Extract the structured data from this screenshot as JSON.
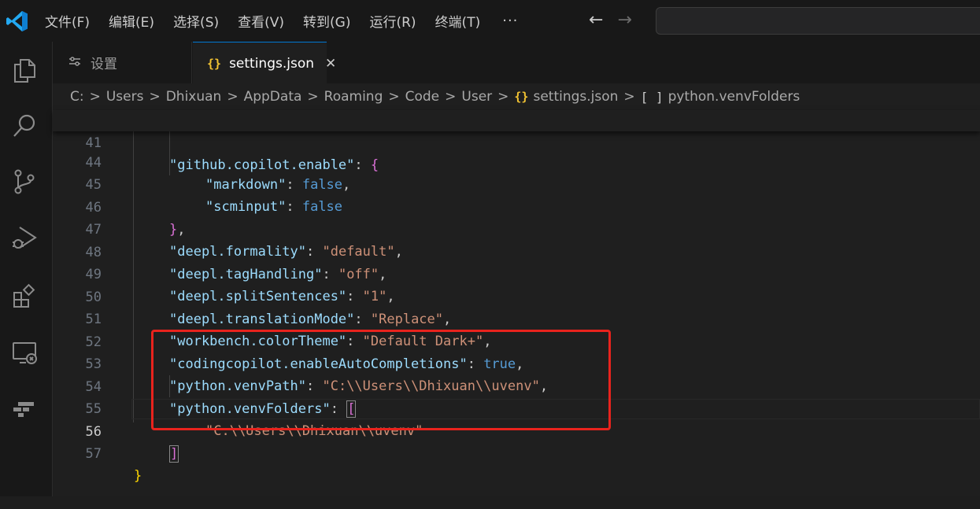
{
  "menu": {
    "items": [
      "文件(F)",
      "编辑(E)",
      "选择(S)",
      "查看(V)",
      "转到(G)",
      "运行(R)",
      "终端(T)"
    ],
    "more": "···"
  },
  "nav": {
    "back": "←",
    "forward": "→"
  },
  "activity_bar": {
    "icons": [
      "explorer-icon",
      "search-icon",
      "source-control-icon",
      "run-debug-icon",
      "extensions-icon",
      "remote-explorer-icon",
      "testing-icon"
    ]
  },
  "tabs": [
    {
      "label": "设置",
      "icon": "settings-icon",
      "active": false
    },
    {
      "label": "settings.json",
      "icon": "json-braces-icon",
      "active": true,
      "close": "✕"
    }
  ],
  "breadcrumb": {
    "items": [
      "C:",
      "Users",
      "Dhixuan",
      "AppData",
      "Roaming",
      "Code",
      "User"
    ],
    "file": "settings.json",
    "file_icon": "{}",
    "symbol": "python.venvFolders",
    "symbol_icon": "[ ]",
    "separator": ">"
  },
  "editor": {
    "lines": [
      {
        "num": "41",
        "tokens": [
          [
            "k",
            "\"github.copilot.enable\""
          ],
          [
            "p",
            ": "
          ],
          [
            "br1",
            "{"
          ]
        ]
      },
      {
        "num": "44",
        "tokens": [
          [
            "k",
            "\"markdown\""
          ],
          [
            "p",
            ": "
          ],
          [
            "b",
            "false"
          ],
          [
            "p",
            ","
          ]
        ]
      },
      {
        "num": "45",
        "tokens": [
          [
            "k",
            "\"scminput\""
          ],
          [
            "p",
            ": "
          ],
          [
            "b",
            "false"
          ]
        ]
      },
      {
        "num": "46",
        "tokens": [
          [
            "br1",
            "}"
          ],
          [
            "p",
            ","
          ]
        ]
      },
      {
        "num": "47",
        "tokens": [
          [
            "k",
            "\"deepl.formality\""
          ],
          [
            "p",
            ": "
          ],
          [
            "s",
            "\"default\""
          ],
          [
            "p",
            ","
          ]
        ]
      },
      {
        "num": "48",
        "tokens": [
          [
            "k",
            "\"deepl.tagHandling\""
          ],
          [
            "p",
            ": "
          ],
          [
            "s",
            "\"off\""
          ],
          [
            "p",
            ","
          ]
        ]
      },
      {
        "num": "49",
        "tokens": [
          [
            "k",
            "\"deepl.splitSentences\""
          ],
          [
            "p",
            ": "
          ],
          [
            "s",
            "\"1\""
          ],
          [
            "p",
            ","
          ]
        ]
      },
      {
        "num": "50",
        "tokens": [
          [
            "k",
            "\"deepl.translationMode\""
          ],
          [
            "p",
            ": "
          ],
          [
            "s",
            "\"Replace\""
          ],
          [
            "p",
            ","
          ]
        ]
      },
      {
        "num": "51",
        "tokens": [
          [
            "k",
            "\"workbench.colorTheme\""
          ],
          [
            "p",
            ": "
          ],
          [
            "s",
            "\"Default Dark+\""
          ],
          [
            "p",
            ","
          ]
        ]
      },
      {
        "num": "52",
        "tokens": [
          [
            "k",
            "\"codingcopilot.enableAutoCompletions\""
          ],
          [
            "p",
            ": "
          ],
          [
            "b",
            "true"
          ],
          [
            "p",
            ","
          ]
        ]
      },
      {
        "num": "53",
        "tokens": [
          [
            "k",
            "\"python.venvPath\""
          ],
          [
            "p",
            ": "
          ],
          [
            "s",
            "\"C:\\\\Users\\\\Dhixuan\\\\uvenv\""
          ],
          [
            "p",
            ","
          ]
        ]
      },
      {
        "num": "54",
        "tokens": [
          [
            "k",
            "\"python.venvFolders\""
          ],
          [
            "p",
            ": "
          ],
          [
            "br1",
            "["
          ]
        ]
      },
      {
        "num": "55",
        "tokens": [
          [
            "s",
            "\"C:\\\\Users\\\\Dhixuan\\\\uvenv\""
          ]
        ]
      },
      {
        "num": "56",
        "tokens": []
      },
      {
        "num": "57",
        "tokens": [
          [
            "br0",
            "}"
          ]
        ]
      }
    ],
    "closing_bracket": "]",
    "active_line": "56"
  },
  "colors": {
    "accent": "#0078d4",
    "json_icon": "#f1c232",
    "highlight_box": "#e8231d",
    "property_key": "#9cdcfe",
    "string_value": "#ce9178",
    "keyword": "#569cd6"
  }
}
